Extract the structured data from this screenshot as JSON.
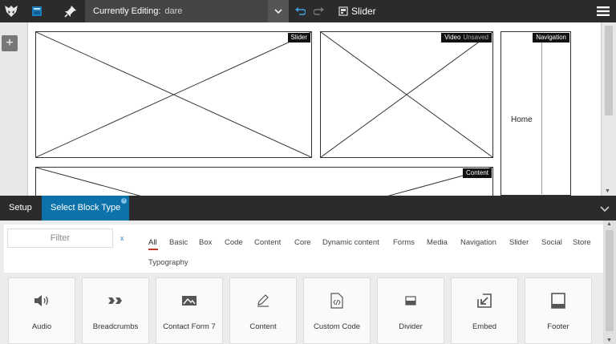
{
  "topbar": {
    "editing_label": "Currently Editing:",
    "editing_value": "dare",
    "template_name": "Slider",
    "icons": [
      "logo-icon",
      "layout-icon",
      "pin-icon",
      "chevron-down-icon",
      "undo-icon",
      "redo-icon",
      "template-icon",
      "hamburger-menu-icon"
    ]
  },
  "canvas": {
    "add_label": "+",
    "blocks": [
      {
        "tag": "Slider"
      },
      {
        "tag": "Video",
        "status": "Unsaved"
      },
      {
        "tag": "Navigation",
        "text": "Home"
      },
      {
        "tag": "Content"
      }
    ]
  },
  "panel": {
    "tabs": [
      {
        "label": "Setup"
      },
      {
        "label": "Select Block Type",
        "active": true
      }
    ],
    "filter": {
      "placeholder": "Filter",
      "clear_label": "x"
    },
    "categories": [
      "All",
      "Basic",
      "Box",
      "Code",
      "Content",
      "Core",
      "Dynamic content",
      "Forms",
      "Media",
      "Navigation",
      "Slider",
      "Social",
      "Store",
      "Typography"
    ],
    "active_category": "All",
    "block_types": [
      {
        "name": "Audio",
        "icon": "audio-icon"
      },
      {
        "name": "Breadcrumbs",
        "icon": "breadcrumbs-icon"
      },
      {
        "name": "Contact Form 7",
        "icon": "contact-form-icon"
      },
      {
        "name": "Content",
        "icon": "pencil-icon"
      },
      {
        "name": "Custom Code",
        "icon": "code-file-icon"
      },
      {
        "name": "Divider",
        "icon": "divider-icon"
      },
      {
        "name": "Embed",
        "icon": "embed-icon"
      },
      {
        "name": "Footer",
        "icon": "footer-icon"
      }
    ]
  },
  "colors": {
    "toolbar_bg": "#2b2b2b",
    "active_tab": "#0d72a9",
    "active_underline": "#c0392b"
  }
}
